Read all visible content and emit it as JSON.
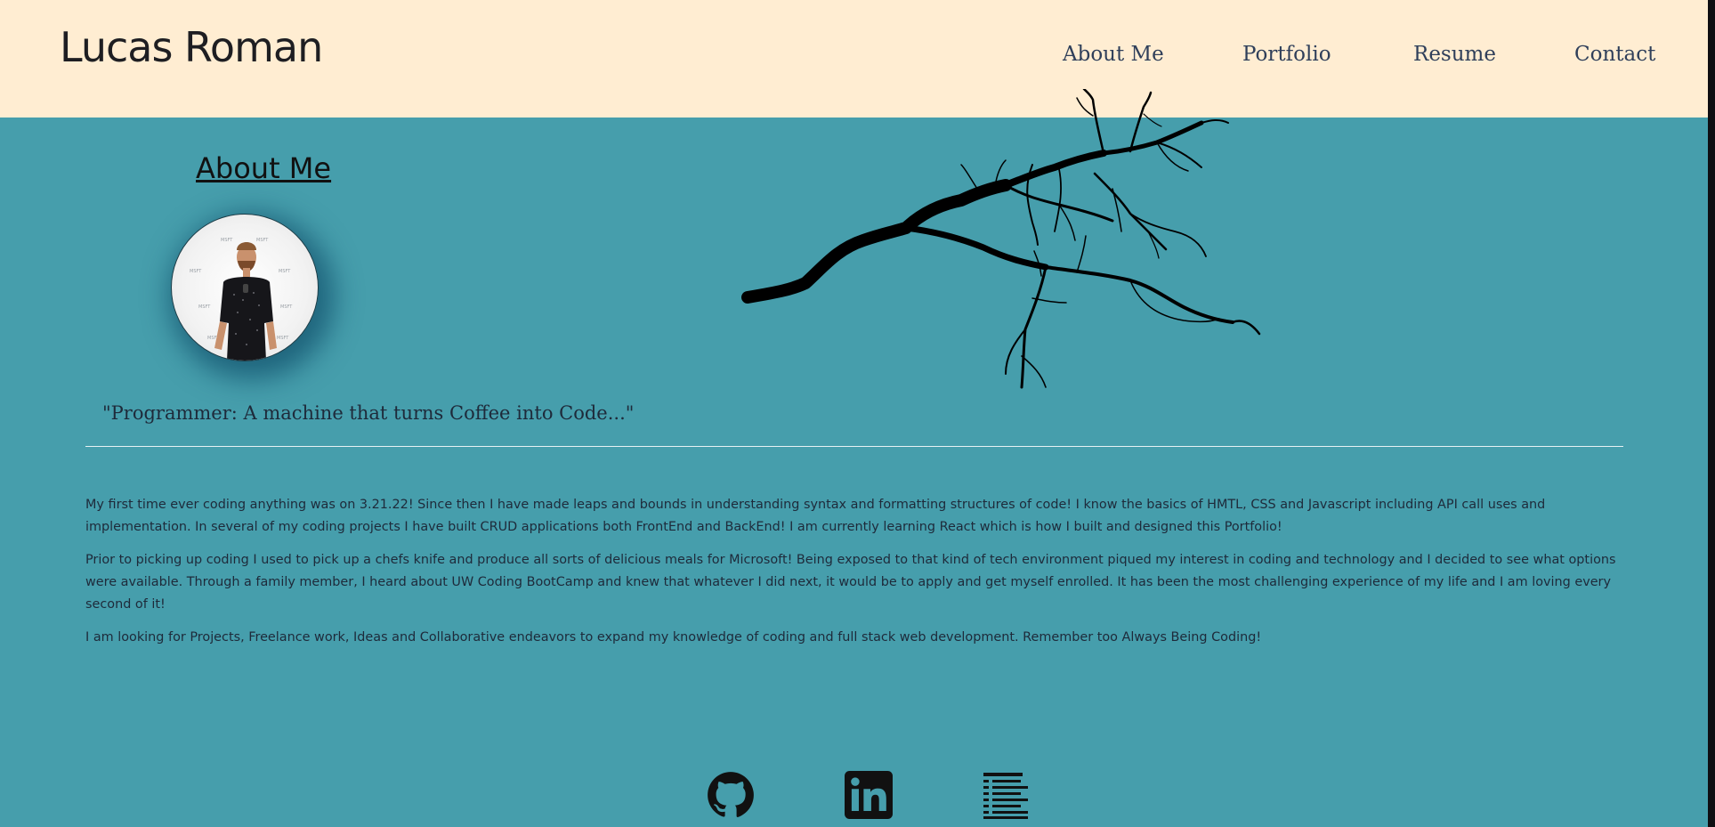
{
  "header": {
    "site_title": "Lucas Roman",
    "nav": {
      "about": "About Me",
      "portfolio": "Portfolio",
      "resume": "Resume",
      "contact": "Contact"
    }
  },
  "about": {
    "heading": "About Me",
    "quote": "\"Programmer: A machine that turns Coffee into Code...\"",
    "bio": [
      "My first time ever coding anything was on 3.21.22! Since then I have made leaps and bounds in understanding syntax and formatting structures of code! I know the basics of HMTL, CSS and Javascript including API call uses and implementation. In several of my coding projects I have built CRUD applications both FrontEnd and BackEnd! I am currently learning React which is how I built and designed this Portfolio!",
      "Prior to picking up coding I used to pick up a chefs knife and produce all sorts of delicious meals for Microsoft! Being exposed to that kind of tech environment piqued my interest in coding and technology and I decided to see what options were available. Through a family member, I heard about UW Coding BootCamp and knew that whatever I did next, it would be to apply and get myself enrolled. It has been the most challenging experience of my life and I am loving every second of it!",
      "I am looking for Projects, Freelance work, Ideas and Collaborative endeavors to expand my knowledge of coding and full stack web development. Remember too Always Being Coding!"
    ]
  },
  "footer": {
    "icons": [
      "github-icon",
      "linkedin-icon",
      "resume-icon"
    ]
  },
  "colors": {
    "header_bg": "#ffedd2",
    "page_bg": "#469eac",
    "text_dark": "#1e2a3a"
  }
}
